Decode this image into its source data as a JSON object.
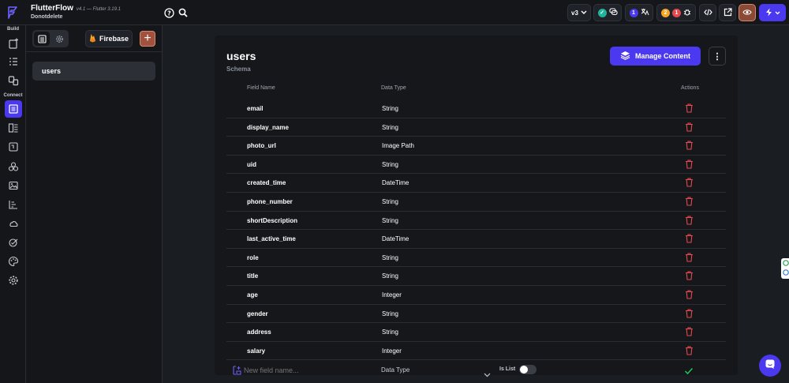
{
  "app": {
    "name": "FlutterFlow",
    "version": "v4.1 — Flutter 3.19.1",
    "project": "Donotdelete"
  },
  "topbar": {
    "version_select": "v3",
    "badge_count_blue": "1",
    "badge_count_orange": "2",
    "badge_count_red": "1",
    "icons": [
      "help-icon",
      "search-icon",
      "check-circle-icon",
      "comment-icon",
      "translate-icon",
      "bug-icon",
      "code-icon",
      "export-icon",
      "preview-eye-icon",
      "lightning-icon"
    ]
  },
  "rail": {
    "build_label": "Build",
    "connect_label": "Connect"
  },
  "panel": {
    "firebase_label": "Firebase",
    "add_label": "+",
    "collections": [
      "users"
    ]
  },
  "main": {
    "title": "users",
    "subtitle": "Schema",
    "manage_button": "Manage Content",
    "more_label": "⋮",
    "headers": {
      "field": "Field Name",
      "type": "Data Type",
      "actions": "Actions"
    },
    "fields": [
      {
        "name": "email",
        "type": "String"
      },
      {
        "name": "display_name",
        "type": "String"
      },
      {
        "name": "photo_url",
        "type": "Image Path"
      },
      {
        "name": "uid",
        "type": "String"
      },
      {
        "name": "created_time",
        "type": "DateTime"
      },
      {
        "name": "phone_number",
        "type": "String"
      },
      {
        "name": "shortDescription",
        "type": "String"
      },
      {
        "name": "last_active_time",
        "type": "DateTime"
      },
      {
        "name": "role",
        "type": "String"
      },
      {
        "name": "title",
        "type": "String"
      },
      {
        "name": "age",
        "type": "Integer"
      },
      {
        "name": "gender",
        "type": "String"
      },
      {
        "name": "address",
        "type": "String"
      },
      {
        "name": "salary",
        "type": "Integer"
      }
    ],
    "new_field": {
      "placeholder": "New field name...",
      "type_label": "Data Type",
      "is_list_label": "Is List",
      "is_list_on": false
    }
  },
  "colors": {
    "accent": "#4b39ef",
    "delete": "#e5484d",
    "success": "#22c55e"
  }
}
